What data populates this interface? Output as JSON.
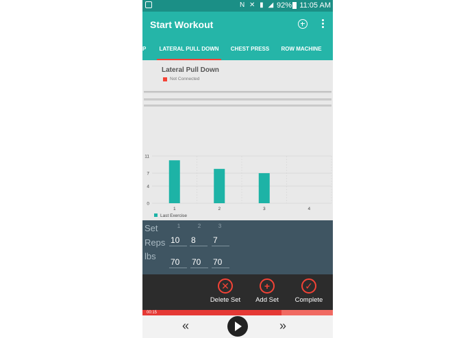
{
  "status_bar": {
    "battery": "92%",
    "time": "11:05 AM",
    "icons": "N ✕ ▮ ◢"
  },
  "app_bar": {
    "title": "Start Workout"
  },
  "tabs": [
    {
      "label": "P"
    },
    {
      "label": "LATERAL PULL DOWN",
      "selected": true
    },
    {
      "label": "CHEST PRESS"
    },
    {
      "label": "ROW MACHINE"
    }
  ],
  "exercise": {
    "title": "Lateral Pull Down",
    "connection_status": "Not Connected"
  },
  "chart_data": {
    "type": "bar",
    "categories": [
      "1",
      "2",
      "3",
      "4"
    ],
    "series": [
      {
        "name": "Last Exercise",
        "values": [
          10,
          8,
          7,
          null
        ],
        "color": "#1db3a6"
      }
    ],
    "yticks": [
      "0",
      "4",
      "7",
      "11"
    ],
    "ylim": [
      0,
      11
    ],
    "grid": true,
    "legend": "bottom-left"
  },
  "sets": {
    "labels": {
      "set": "Set",
      "reps": "Reps",
      "lbs": "lbs"
    },
    "numbers": [
      "1",
      "2",
      "3"
    ],
    "reps": [
      "10",
      "8",
      "7"
    ],
    "lbs": [
      "70",
      "70",
      "70"
    ]
  },
  "actions": {
    "delete": "Delete Set",
    "add": "Add Set",
    "complete": "Complete"
  },
  "player": {
    "elapsed": "00:15",
    "progress": 0.73
  },
  "colors": {
    "accent": "#25b5a8",
    "status_bar": "#1b8f86",
    "red": "#f44336",
    "panel": "#3f5562"
  }
}
